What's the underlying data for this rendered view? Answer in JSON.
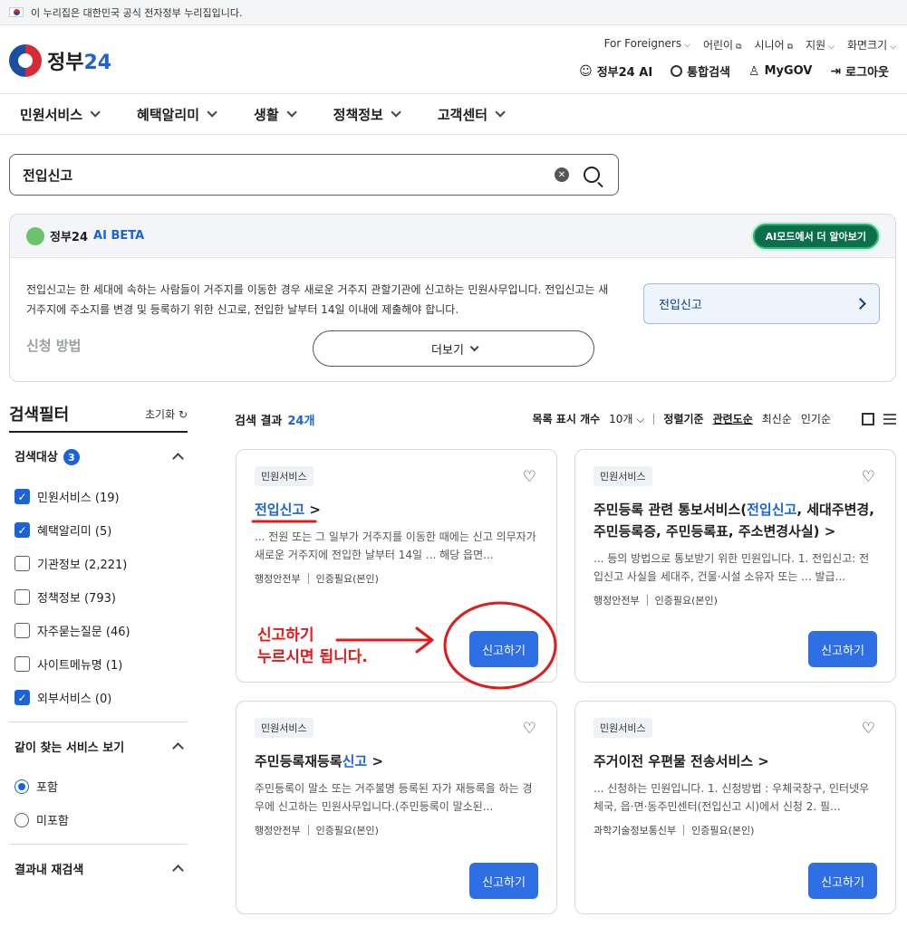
{
  "banner": {
    "text": "이 누리집은 대한민국 공식 전자정부 누리집입니다."
  },
  "header": {
    "logo": "정부",
    "logo_num": "24",
    "utils": [
      "For Foreigners",
      "어린이",
      "시니어",
      "지원",
      "화면크기"
    ],
    "links": [
      "정부24 AI",
      "통합검색",
      "MyGOV",
      "로그아웃"
    ]
  },
  "gnb": [
    "민원서비스",
    "혜택알리미",
    "생활",
    "정책정보",
    "고객센터"
  ],
  "search": {
    "value": "전입신고"
  },
  "ai": {
    "brand": "정부24",
    "beta": "AI BETA",
    "mode_button": "AI모드에서 더 알아보기",
    "text": "전입신고는 한 세대에 속하는 사람들이 거주지를 이동한 경우 새로운 거주지 관할기관에 신고하는 민원사무입니다. 전입신고는 새 거주지에 주소지를 변경 및 등록하기 위한 신고로, 전입한 날부터 14일 이내에 제출해야 합니다.",
    "subheading": "신청 방법",
    "more": "더보기",
    "link": "전입신고"
  },
  "filter": {
    "title": "검색필터",
    "reset": "초기화",
    "section1": {
      "title": "검색대상",
      "count": "3"
    },
    "options": [
      {
        "label": "민원서비스 (19)",
        "checked": true
      },
      {
        "label": "혜택알리미 (5)",
        "checked": true
      },
      {
        "label": "기관정보 (2,221)",
        "checked": false
      },
      {
        "label": "정책정보 (793)",
        "checked": false
      },
      {
        "label": "자주묻는질문 (46)",
        "checked": false
      },
      {
        "label": "사이트메뉴명 (1)",
        "checked": false
      },
      {
        "label": "외부서비스 (0)",
        "checked": true
      }
    ],
    "section2": {
      "title": "같이 찾는 서비스 보기"
    },
    "radios": [
      {
        "label": "포함",
        "checked": true
      },
      {
        "label": "미포함",
        "checked": false
      }
    ],
    "section3": {
      "title": "결과내 재검색"
    }
  },
  "results": {
    "label": "검색 결과",
    "count": "24개",
    "per_page_label": "목록 표시 개수",
    "per_page": "10개",
    "sort_label": "정렬기준",
    "sorts": [
      "관련도순",
      "최신순",
      "인기순"
    ]
  },
  "cards": [
    {
      "tag": "민원서비스",
      "title_plain": "",
      "title_hl": "전입신고",
      "title_rest": " >",
      "desc": "... 전원 또는 그 일부가 거주지를 이동한 때에는 신고 의무자가 새로운 거주지에 전입한 날부터 14일 ... 해당 읍면...",
      "meta1": "행정안전부",
      "meta2": "인증필요(본인)",
      "button": "신고하기"
    },
    {
      "tag": "민원서비스",
      "title_plain": "주민등록 관련 통보서비스(",
      "title_hl": "전입신고",
      "title_rest": ", 세대주변경, 주민등록증, 주민등록표, 주소변경사실) >",
      "desc": "... 등의 방법으로 통보받기 위한 민원입니다. 1. 전입신고: 전입신고 사실을 세대주, 건물·시설 소유자 또는 ... 발급...",
      "meta1": "행정안전부",
      "meta2": "인증필요(본인)",
      "button": "신고하기"
    },
    {
      "tag": "민원서비스",
      "title_plain": "주민등록재등록",
      "title_hl": "신고",
      "title_rest": " >",
      "desc": "주민등록이 말소 또는 거주불명 등록된 자가 재등록을 하는 경우에 신고하는 민원사무입니다.(주민등록이 말소된...",
      "meta1": "행정안전부",
      "meta2": "인증필요(본인)",
      "button": "신고하기"
    },
    {
      "tag": "민원서비스",
      "title_plain": "주거이전 우편물 전송서비스",
      "title_hl": "",
      "title_rest": " >",
      "desc": "... 신청하는 민원입니다. 1. 신청방법 : 우체국창구, 인터넷우체국, 읍·면·동주민센터(전입신고 시)에서 신청 2. 필...",
      "meta1": "과학기술정보통신부",
      "meta2": "인증필요(본인)",
      "button": "신고하기"
    }
  ],
  "annotation": {
    "line1": "신고하기",
    "line2": "누르시면 됩니다."
  }
}
